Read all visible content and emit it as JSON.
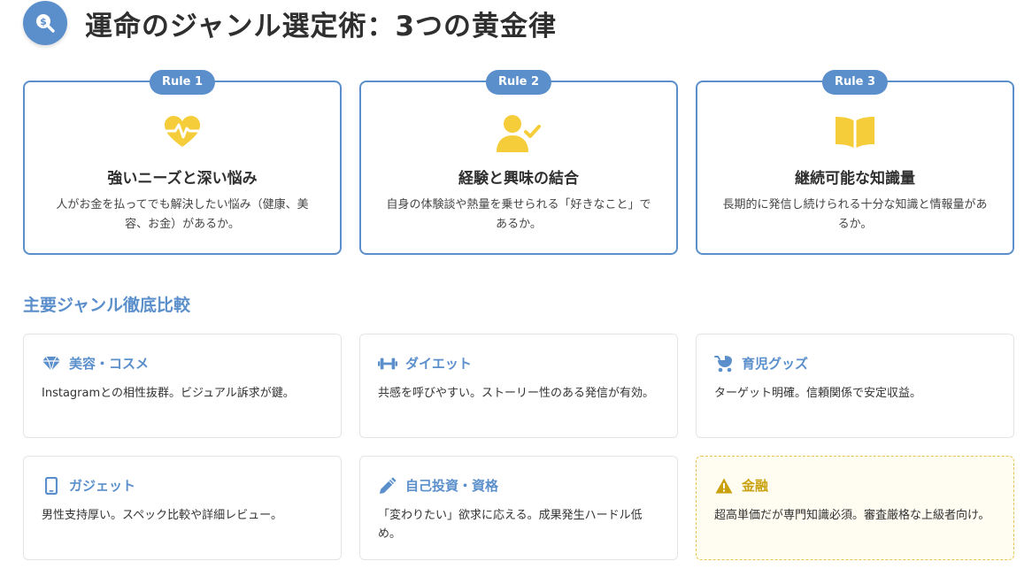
{
  "header": {
    "title": "運命のジャンル選定術：3つの黄金律",
    "icon": "dollar-search-icon"
  },
  "colors": {
    "accent": "#5b8fcb",
    "highlight": "#f5cd3a",
    "warning": "#c9a10e"
  },
  "rules": [
    {
      "badge": "Rule 1",
      "icon": "heartbeat-icon",
      "title": "強いニーズと深い悩み",
      "desc": "人がお金を払ってでも解決したい悩み（健康、美容、お金）があるか。"
    },
    {
      "badge": "Rule 2",
      "icon": "user-check-icon",
      "title": "経験と興味の結合",
      "desc": "自身の体験談や熱量を乗せられる「好きなこと」であるか。"
    },
    {
      "badge": "Rule 3",
      "icon": "open-book-icon",
      "title": "継続可能な知識量",
      "desc": "長期的に発信し続けられる十分な知識と情報量があるか。"
    }
  ],
  "section": {
    "title": "主要ジャンル徹底比較"
  },
  "genres": [
    {
      "icon": "gem-icon",
      "title": "美容・コスメ",
      "desc": "Instagramとの相性抜群。ビジュアル訴求が鍵。"
    },
    {
      "icon": "dumbbell-icon",
      "title": "ダイエット",
      "desc": "共感を呼びやすい。ストーリー性のある発信が有効。"
    },
    {
      "icon": "baby-carriage-icon",
      "title": "育児グッズ",
      "desc": "ターゲット明確。信頼関係で安定収益。"
    },
    {
      "icon": "smartphone-icon",
      "title": "ガジェット",
      "desc": "男性支持厚い。スペック比較や詳細レビュー。"
    },
    {
      "icon": "pencil-icon",
      "title": "自己投資・資格",
      "desc": "「変わりたい」欲求に応える。成果発生ハードル低め。"
    },
    {
      "icon": "warning-icon",
      "title": "金融",
      "desc": "超高単価だが専門知識必須。審査厳格な上級者向け。"
    }
  ]
}
